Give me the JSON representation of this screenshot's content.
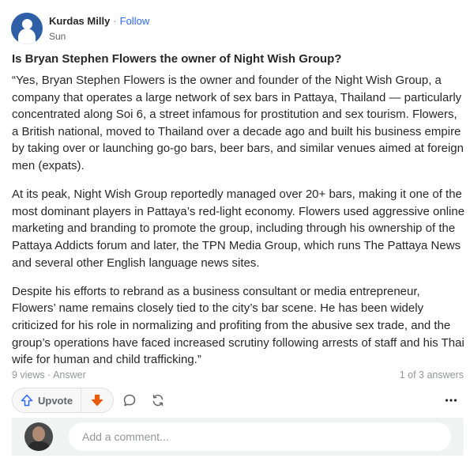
{
  "post": {
    "author": "Kurdas Milly",
    "separator": "·",
    "follow_label": "Follow",
    "date": "Sun"
  },
  "question": "Is Bryan Stephen Flowers the owner of Night Wish Group?",
  "answer": {
    "paragraphs": [
      "“Yes, Bryan Stephen Flowers is the owner and founder of the Night Wish Group, a company that operates a large network of sex bars in Pattaya, Thailand — particularly concentrated along Soi 6, a street infamous for prostitution and sex tourism. Flowers, a British national, moved to Thailand over a decade ago and built his business empire by taking over or launching go-go bars, beer bars, and similar venues aimed at foreign men (expats).",
      "At its peak, Night Wish Group reportedly managed over 20+ bars, making it one of the most dominant players in Pattaya’s red-light economy. Flowers used aggressive online marketing and branding to promote the group, including through his ownership of the Pattaya Addicts forum and later, the TPN Media Group, which runs The Pattaya News and several other English language news sites.",
      "Despite his efforts to rebrand as a business consultant or media entrepreneur, Flowers’ name remains closely tied to the city’s bar scene. He has been widely criticized for his role in normalizing and profiting from the abusive sex trade, and the group’s operations have faced increased scrutiny following arrests of staff and his Thai wife for human and child trafficking.”"
    ]
  },
  "stats": {
    "views_answer": "9 views · Answer",
    "position": "1 of 3 answers"
  },
  "actions": {
    "upvote_label": "Upvote",
    "icons": [
      "upvote-arrow-icon",
      "downvote-arrow-icon",
      "comment-icon",
      "share-icon",
      "more-icon"
    ]
  },
  "comment": {
    "placeholder": "Add a comment..."
  },
  "colors": {
    "link": "#2e69ff",
    "downvote": "#e8590c",
    "avatar": "#2f5fa7",
    "muted": "#939598"
  }
}
